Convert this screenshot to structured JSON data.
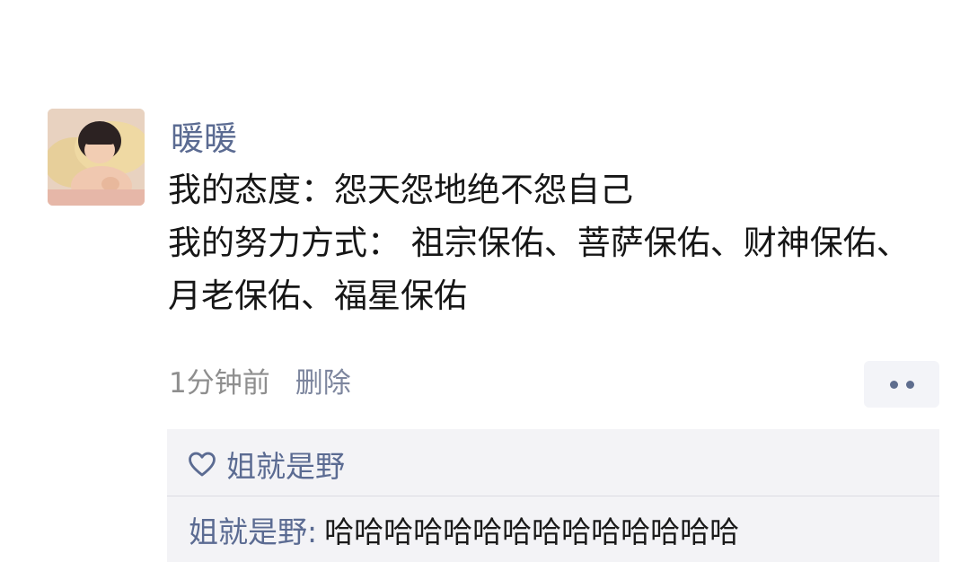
{
  "post": {
    "author": "暖暖",
    "content_lines": [
      "我的态度：怨天怨地绝不怨自己",
      "我的努力方式： 祖宗保佑、菩萨保佑、财神保佑、月老保佑、福星保佑"
    ],
    "timestamp": "1分钟前",
    "delete_label": "删除",
    "avatar_icon": "baby-photo-avatar",
    "more_icon": "more-dots-icon"
  },
  "likes": {
    "icon": "heart-icon",
    "names": "姐就是野"
  },
  "comments": [
    {
      "author": "姐就是野",
      "separator": ":",
      "text": "哈哈哈哈哈哈哈哈哈哈哈哈哈哈"
    }
  ],
  "colors": {
    "name_blue": "#5b6b92",
    "panel_bg": "#f3f3f6",
    "meta_gray": "#8e8e8e"
  }
}
